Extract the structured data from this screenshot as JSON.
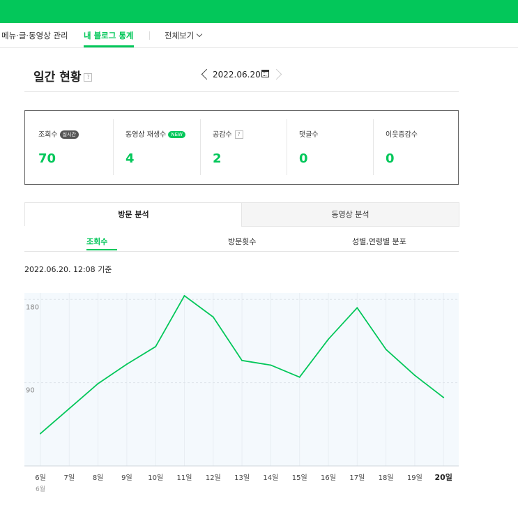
{
  "nav": {
    "items": [
      {
        "label": "메뉴·글·동영상 관리",
        "active": false
      },
      {
        "label": "내 블로그 통계",
        "active": true
      },
      {
        "label": "전체보기",
        "active": false
      }
    ]
  },
  "header": {
    "title": "일간 현황",
    "help_icon": "?",
    "date": "2022.06.20."
  },
  "stats": [
    {
      "label": "조회수",
      "badge": "실시간",
      "value": "70"
    },
    {
      "label": "동영상 재생수",
      "badge": "NEW",
      "value": "4"
    },
    {
      "label": "공감수",
      "help": "?",
      "value": "2"
    },
    {
      "label": "댓글수",
      "value": "0"
    },
    {
      "label": "이웃증감수",
      "value": "0"
    }
  ],
  "tabs": [
    "방문 분석",
    "동영상 분석"
  ],
  "subtabs": [
    "조회수",
    "방문횟수",
    "성별,연령별 분포"
  ],
  "basis_text": "2022.06.20. 12:08 기준",
  "chart_data": {
    "type": "line",
    "categories": [
      "6일",
      "7일",
      "8일",
      "9일",
      "10일",
      "11일",
      "12일",
      "13일",
      "14일",
      "15일",
      "16일",
      "17일",
      "18일",
      "19일",
      "20일"
    ],
    "x_sublabel": "6월",
    "values": [
      35,
      62,
      89,
      110,
      129,
      184,
      161,
      114,
      109,
      96,
      137,
      171,
      126,
      98,
      74
    ],
    "yticks": [
      "180",
      "90"
    ],
    "ylim": [
      0,
      184
    ],
    "grid": true,
    "colors": {
      "line": "#03c75a",
      "plot_bg": "#f4f9fd",
      "grid": "#dde4ea"
    }
  },
  "colors": {
    "brand": "#03c75a"
  }
}
